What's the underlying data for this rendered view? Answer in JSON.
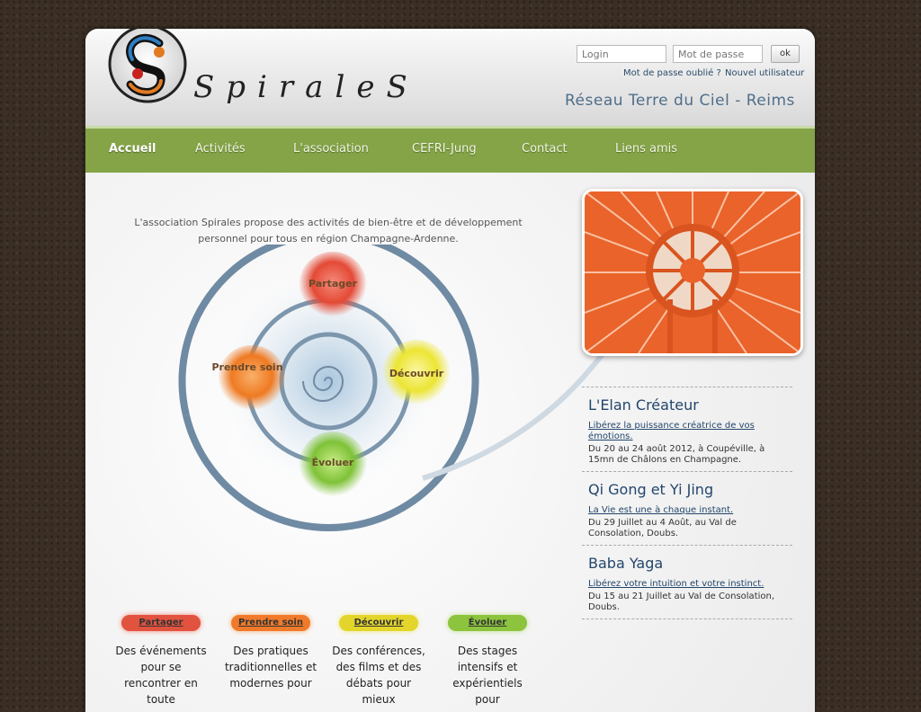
{
  "brand": {
    "name": "SpiraleS",
    "network": "Réseau Terre du Ciel - Reims"
  },
  "login": {
    "login_placeholder": "Login",
    "password_placeholder": "Mot de passe",
    "submit_label": "ok",
    "forgot_link": "Mot de passe oublié ?",
    "new_user_link": "Nouvel utilisateur"
  },
  "nav": {
    "items": [
      {
        "label": "Accueil"
      },
      {
        "label": "Activités"
      },
      {
        "label": "L'association"
      },
      {
        "label": "CEFRI-Jung"
      },
      {
        "label": "Contact"
      },
      {
        "label": "Liens amis"
      }
    ]
  },
  "intro": {
    "text": "L'association Spirales propose des activités de bien-être et de développement personnel pour tous en région Champagne-Ardenne."
  },
  "diagram": {
    "partager": "Partager",
    "prendre_soin": "Prendre soin",
    "decouvrir": "Découvrir",
    "evoluer": "Évoluer"
  },
  "events": [
    {
      "title": "L'Elan Créateur",
      "subtitle": "Libérez la puissance créatrice de vos émotions.",
      "date": "Du 20 au 24 août 2012, à Coupéville, à 15mn de Châlons en Champagne."
    },
    {
      "title": "Qi Gong et Yi Jing",
      "subtitle": "La Vie est une à chaque instant.",
      "date": "Du 29 Juillet au 4 Août, au Val de Consolation, Doubs."
    },
    {
      "title": "Baba Yaga",
      "subtitle": "Libérez votre intuition et votre instinct.",
      "date": "Du 15 au 21 Juillet au Val de Consolation, Doubs."
    }
  ],
  "pills": [
    {
      "label": "Partager",
      "desc": "Des événements pour se rencontrer en toute",
      "color": "#e2533f"
    },
    {
      "label": "Prendre soin",
      "desc": "Des pratiques traditionnelles et modernes pour",
      "color": "#f07a2a"
    },
    {
      "label": "Découvrir",
      "desc": "Des conférences, des films et des débats pour mieux",
      "color": "#e3d52b"
    },
    {
      "label": "Évoluer",
      "desc": "Des stages intensifs et expérientiels pour",
      "color": "#8cc43d"
    }
  ]
}
